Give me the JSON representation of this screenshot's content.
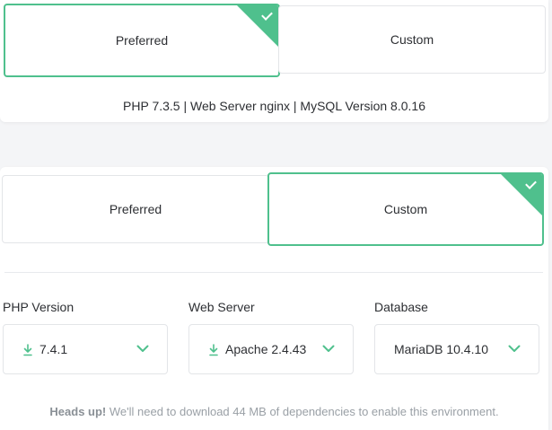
{
  "panel1": {
    "options": [
      {
        "label": "Preferred",
        "selected": true
      },
      {
        "label": "Custom",
        "selected": false
      }
    ],
    "env_summary": "PHP 7.3.5 | Web Server nginx | MySQL Version 8.0.16"
  },
  "panel2": {
    "options": [
      {
        "label": "Preferred",
        "selected": false
      },
      {
        "label": "Custom",
        "selected": true
      }
    ],
    "fields": {
      "php": {
        "label": "PHP Version",
        "value": "7.4.1",
        "icon": "download-icon"
      },
      "webserver": {
        "label": "Web Server",
        "value": "Apache 2.4.43",
        "icon": "download-icon"
      },
      "database": {
        "label": "Database",
        "value": "MariaDB 10.4.10"
      }
    },
    "note": {
      "bold": "Heads up!",
      "text": " We'll need to download 44 MB of dependencies to enable this environment."
    }
  },
  "colors": {
    "accent": "#4fc08d",
    "text": "#2d2f33",
    "muted": "#9aa0a6",
    "border": "#e3e5e8",
    "background": "#f4f5f7"
  }
}
